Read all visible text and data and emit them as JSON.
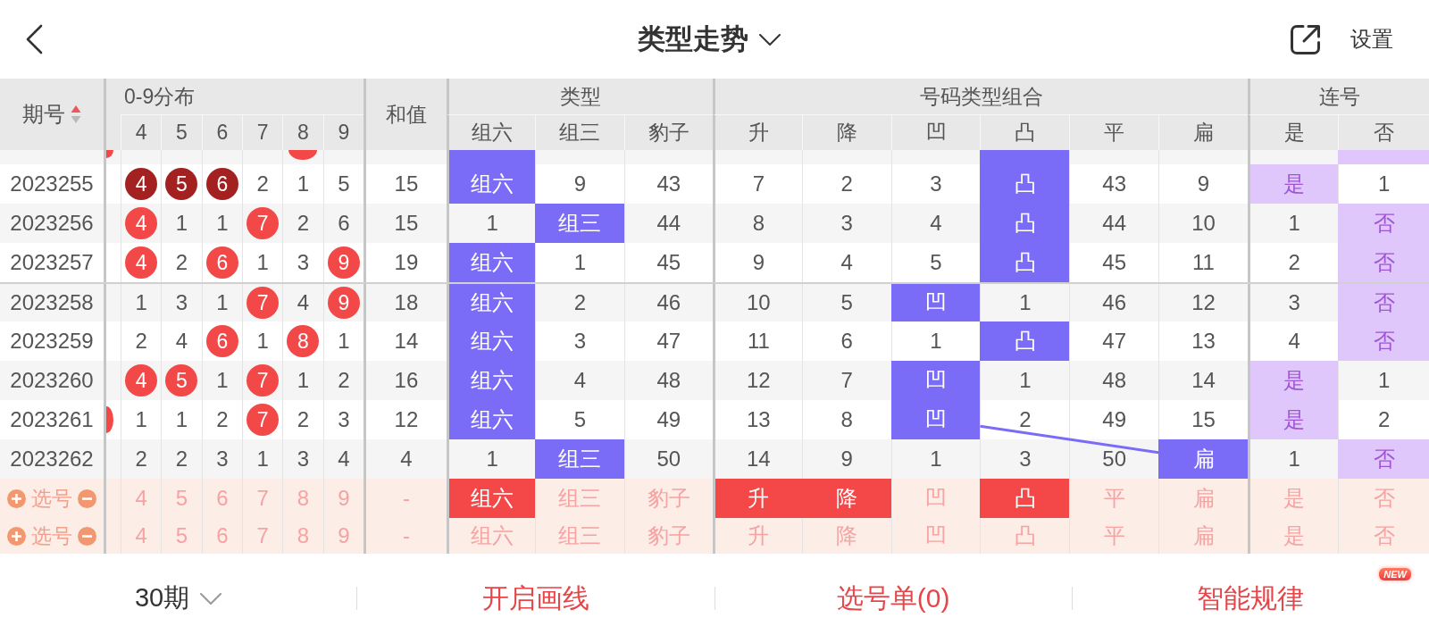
{
  "top_bar": {
    "title": "类型走势",
    "settings": "设置"
  },
  "table": {
    "header": {
      "issue": "期号",
      "sort_ascending": true,
      "distribution": {
        "title": "0-9分布",
        "digits": [
          "4",
          "5",
          "6",
          "7",
          "8",
          "9"
        ]
      },
      "sum": "和值",
      "type": {
        "title": "类型",
        "columns": [
          "组六",
          "组三",
          "豹子"
        ]
      },
      "combo": {
        "title": "号码类型组合",
        "columns": [
          "升",
          "降",
          "凹",
          "凸",
          "平",
          "扁"
        ]
      },
      "consecutive": {
        "title": "连号",
        "columns": [
          "是",
          "否"
        ]
      }
    },
    "rows": [
      {
        "clipped": true,
        "separator": false,
        "edge_hit": true,
        "digits": [
          {
            "hit": false
          },
          {
            "hit": false
          },
          {
            "hit": false
          },
          {
            "hit": false
          },
          {
            "hit": true,
            "color": "#f24848"
          },
          {
            "hit": false
          }
        ],
        "types": [
          {
            "highlight": true
          },
          {
            "highlight": false
          },
          {
            "highlight": false
          }
        ],
        "combo": [
          {
            "highlight": false
          },
          {
            "highlight": false
          },
          {
            "highlight": false
          },
          {
            "highlight": true
          },
          {
            "highlight": false
          },
          {
            "highlight": false
          }
        ],
        "consecutive": [
          {
            "highlight": false
          },
          {
            "highlight": true
          }
        ]
      },
      {
        "clipped": false,
        "separator": false,
        "issue": "2023255",
        "edge_hit": false,
        "digits": [
          {
            "value": "4",
            "hit": true,
            "color": "#a32121"
          },
          {
            "value": "5",
            "hit": true,
            "color": "#a32121"
          },
          {
            "value": "6",
            "hit": true,
            "color": "#a32121"
          },
          {
            "value": "2",
            "hit": false
          },
          {
            "value": "1",
            "hit": false
          },
          {
            "value": "5",
            "hit": false
          }
        ],
        "sum": "15",
        "types": [
          {
            "value": "组六",
            "highlight": true
          },
          {
            "value": "9",
            "highlight": false
          },
          {
            "value": "43",
            "highlight": false
          }
        ],
        "combo": [
          {
            "value": "7",
            "highlight": false
          },
          {
            "value": "2",
            "highlight": false
          },
          {
            "value": "3",
            "highlight": false
          },
          {
            "value": "凸",
            "highlight": true
          },
          {
            "value": "43",
            "highlight": false
          },
          {
            "value": "9",
            "highlight": false
          }
        ],
        "consecutive": [
          {
            "value": "是",
            "highlight": true
          },
          {
            "value": "1",
            "highlight": false
          }
        ]
      },
      {
        "clipped": false,
        "separator": false,
        "issue": "2023256",
        "edge_hit": false,
        "digits": [
          {
            "value": "4",
            "hit": true,
            "color": "#f24848"
          },
          {
            "value": "1",
            "hit": false
          },
          {
            "value": "1",
            "hit": false
          },
          {
            "value": "7",
            "hit": true,
            "color": "#f24848"
          },
          {
            "value": "2",
            "hit": false
          },
          {
            "value": "6",
            "hit": false
          }
        ],
        "sum": "15",
        "types": [
          {
            "value": "1",
            "highlight": false
          },
          {
            "value": "组三",
            "highlight": true
          },
          {
            "value": "44",
            "highlight": false
          }
        ],
        "combo": [
          {
            "value": "8",
            "highlight": false
          },
          {
            "value": "3",
            "highlight": false
          },
          {
            "value": "4",
            "highlight": false
          },
          {
            "value": "凸",
            "highlight": true
          },
          {
            "value": "44",
            "highlight": false
          },
          {
            "value": "10",
            "highlight": false
          }
        ],
        "consecutive": [
          {
            "value": "1",
            "highlight": false
          },
          {
            "value": "否",
            "highlight": true
          }
        ]
      },
      {
        "clipped": false,
        "separator": false,
        "issue": "2023257",
        "edge_hit": false,
        "digits": [
          {
            "value": "4",
            "hit": true,
            "color": "#f24848"
          },
          {
            "value": "2",
            "hit": false
          },
          {
            "value": "6",
            "hit": true,
            "color": "#f24848"
          },
          {
            "value": "1",
            "hit": false
          },
          {
            "value": "3",
            "hit": false
          },
          {
            "value": "9",
            "hit": true,
            "color": "#f24848"
          }
        ],
        "sum": "19",
        "types": [
          {
            "value": "组六",
            "highlight": true
          },
          {
            "value": "1",
            "highlight": false
          },
          {
            "value": "45",
            "highlight": false
          }
        ],
        "combo": [
          {
            "value": "9",
            "highlight": false
          },
          {
            "value": "4",
            "highlight": false
          },
          {
            "value": "5",
            "highlight": false
          },
          {
            "value": "凸",
            "highlight": true
          },
          {
            "value": "45",
            "highlight": false
          },
          {
            "value": "11",
            "highlight": false
          }
        ],
        "consecutive": [
          {
            "value": "2",
            "highlight": false
          },
          {
            "value": "否",
            "highlight": true
          }
        ]
      },
      {
        "clipped": false,
        "separator": true,
        "issue": "2023258",
        "edge_hit": false,
        "digits": [
          {
            "value": "1",
            "hit": false
          },
          {
            "value": "3",
            "hit": false
          },
          {
            "value": "1",
            "hit": false
          },
          {
            "value": "7",
            "hit": true,
            "color": "#f24848"
          },
          {
            "value": "4",
            "hit": false
          },
          {
            "value": "9",
            "hit": true,
            "color": "#f24848"
          }
        ],
        "sum": "18",
        "types": [
          {
            "value": "组六",
            "highlight": true
          },
          {
            "value": "2",
            "highlight": false
          },
          {
            "value": "46",
            "highlight": false
          }
        ],
        "combo": [
          {
            "value": "10",
            "highlight": false
          },
          {
            "value": "5",
            "highlight": false
          },
          {
            "value": "凹",
            "highlight": true
          },
          {
            "value": "1",
            "highlight": false
          },
          {
            "value": "46",
            "highlight": false
          },
          {
            "value": "12",
            "highlight": false
          }
        ],
        "consecutive": [
          {
            "value": "3",
            "highlight": false
          },
          {
            "value": "否",
            "highlight": true
          }
        ]
      },
      {
        "clipped": false,
        "separator": false,
        "issue": "2023259",
        "edge_hit": false,
        "digits": [
          {
            "value": "2",
            "hit": false
          },
          {
            "value": "4",
            "hit": false
          },
          {
            "value": "6",
            "hit": true,
            "color": "#f24848"
          },
          {
            "value": "1",
            "hit": false
          },
          {
            "value": "8",
            "hit": true,
            "color": "#f24848"
          },
          {
            "value": "1",
            "hit": false
          }
        ],
        "sum": "14",
        "types": [
          {
            "value": "组六",
            "highlight": true
          },
          {
            "value": "3",
            "highlight": false
          },
          {
            "value": "47",
            "highlight": false
          }
        ],
        "combo": [
          {
            "value": "11",
            "highlight": false
          },
          {
            "value": "6",
            "highlight": false
          },
          {
            "value": "1",
            "highlight": false
          },
          {
            "value": "凸",
            "highlight": true
          },
          {
            "value": "47",
            "highlight": false
          },
          {
            "value": "13",
            "highlight": false
          }
        ],
        "consecutive": [
          {
            "value": "4",
            "highlight": false
          },
          {
            "value": "否",
            "highlight": true
          }
        ]
      },
      {
        "clipped": false,
        "separator": false,
        "issue": "2023260",
        "edge_hit": false,
        "digits": [
          {
            "value": "4",
            "hit": true,
            "color": "#f24848"
          },
          {
            "value": "5",
            "hit": true,
            "color": "#f24848"
          },
          {
            "value": "1",
            "hit": false
          },
          {
            "value": "7",
            "hit": true,
            "color": "#f24848"
          },
          {
            "value": "1",
            "hit": false
          },
          {
            "value": "2",
            "hit": false
          }
        ],
        "sum": "16",
        "types": [
          {
            "value": "组六",
            "highlight": true
          },
          {
            "value": "4",
            "highlight": false
          },
          {
            "value": "48",
            "highlight": false
          }
        ],
        "combo": [
          {
            "value": "12",
            "highlight": false
          },
          {
            "value": "7",
            "highlight": false
          },
          {
            "value": "凹",
            "highlight": true
          },
          {
            "value": "1",
            "highlight": false
          },
          {
            "value": "48",
            "highlight": false
          },
          {
            "value": "14",
            "highlight": false
          }
        ],
        "consecutive": [
          {
            "value": "是",
            "highlight": true
          },
          {
            "value": "1",
            "highlight": false
          }
        ]
      },
      {
        "clipped": false,
        "separator": false,
        "issue": "2023261",
        "edge_hit": true,
        "digits": [
          {
            "value": "1",
            "hit": false
          },
          {
            "value": "1",
            "hit": false
          },
          {
            "value": "2",
            "hit": false
          },
          {
            "value": "7",
            "hit": true,
            "color": "#f24848"
          },
          {
            "value": "2",
            "hit": false
          },
          {
            "value": "3",
            "hit": false
          }
        ],
        "sum": "12",
        "types": [
          {
            "value": "组六",
            "highlight": true
          },
          {
            "value": "5",
            "highlight": false
          },
          {
            "value": "49",
            "highlight": false
          }
        ],
        "combo": [
          {
            "value": "13",
            "highlight": false
          },
          {
            "value": "8",
            "highlight": false
          },
          {
            "value": "凹",
            "highlight": true
          },
          {
            "value": "2",
            "highlight": false
          },
          {
            "value": "49",
            "highlight": false
          },
          {
            "value": "15",
            "highlight": false
          }
        ],
        "consecutive": [
          {
            "value": "是",
            "highlight": true
          },
          {
            "value": "2",
            "highlight": false
          }
        ]
      },
      {
        "clipped": false,
        "separator": false,
        "issue": "2023262",
        "edge_hit": false,
        "digits": [
          {
            "value": "2",
            "hit": false
          },
          {
            "value": "2",
            "hit": false
          },
          {
            "value": "3",
            "hit": false
          },
          {
            "value": "1",
            "hit": false
          },
          {
            "value": "3",
            "hit": false
          },
          {
            "value": "4",
            "hit": false
          }
        ],
        "sum": "4",
        "types": [
          {
            "value": "1",
            "highlight": false
          },
          {
            "value": "组三",
            "highlight": true
          },
          {
            "value": "50",
            "highlight": false
          }
        ],
        "combo": [
          {
            "value": "14",
            "highlight": false
          },
          {
            "value": "9",
            "highlight": false
          },
          {
            "value": "1",
            "highlight": false
          },
          {
            "value": "3",
            "highlight": false
          },
          {
            "value": "50",
            "highlight": false
          },
          {
            "value": "扁",
            "highlight": true
          }
        ],
        "consecutive": [
          {
            "value": "1",
            "highlight": false
          },
          {
            "value": "否",
            "highlight": true
          }
        ]
      }
    ],
    "pick_rows": [
      {
        "label": "选号",
        "digits": [
          {
            "value": "4",
            "selected": false
          },
          {
            "value": "5",
            "selected": false
          },
          {
            "value": "6",
            "selected": false
          },
          {
            "value": "7",
            "selected": false
          },
          {
            "value": "8",
            "selected": false
          },
          {
            "value": "9",
            "selected": false
          }
        ],
        "sum": "-",
        "types": [
          {
            "value": "组六",
            "selected": true
          },
          {
            "value": "组三",
            "selected": false
          },
          {
            "value": "豹子",
            "selected": false
          }
        ],
        "combo": [
          {
            "value": "升",
            "selected": true
          },
          {
            "value": "降",
            "selected": true
          },
          {
            "value": "凹",
            "selected": false
          },
          {
            "value": "凸",
            "selected": true
          },
          {
            "value": "平",
            "selected": false
          },
          {
            "value": "扁",
            "selected": false
          }
        ],
        "consecutive": [
          {
            "value": "是",
            "selected": false
          },
          {
            "value": "否",
            "selected": false
          }
        ]
      },
      {
        "label": "选号",
        "digits": [
          {
            "value": "4",
            "selected": false
          },
          {
            "value": "5",
            "selected": false
          },
          {
            "value": "6",
            "selected": false
          },
          {
            "value": "7",
            "selected": false
          },
          {
            "value": "8",
            "selected": false
          },
          {
            "value": "9",
            "selected": false
          }
        ],
        "sum": "-",
        "types": [
          {
            "value": "组六",
            "selected": false
          },
          {
            "value": "组三",
            "selected": false
          },
          {
            "value": "豹子",
            "selected": false
          }
        ],
        "combo": [
          {
            "value": "升",
            "selected": false
          },
          {
            "value": "降",
            "selected": false
          },
          {
            "value": "凹",
            "selected": false
          },
          {
            "value": "凸",
            "selected": false
          },
          {
            "value": "平",
            "selected": false
          },
          {
            "value": "扁",
            "selected": false
          }
        ],
        "consecutive": [
          {
            "value": "是",
            "selected": false
          },
          {
            "value": "否",
            "selected": false
          }
        ]
      }
    ]
  },
  "bottom_bar": {
    "period": "30期",
    "actions": [
      {
        "label": "开启画线"
      },
      {
        "label": "选号单(0)"
      },
      {
        "label": "智能规律",
        "badge": "NEW"
      }
    ]
  }
}
